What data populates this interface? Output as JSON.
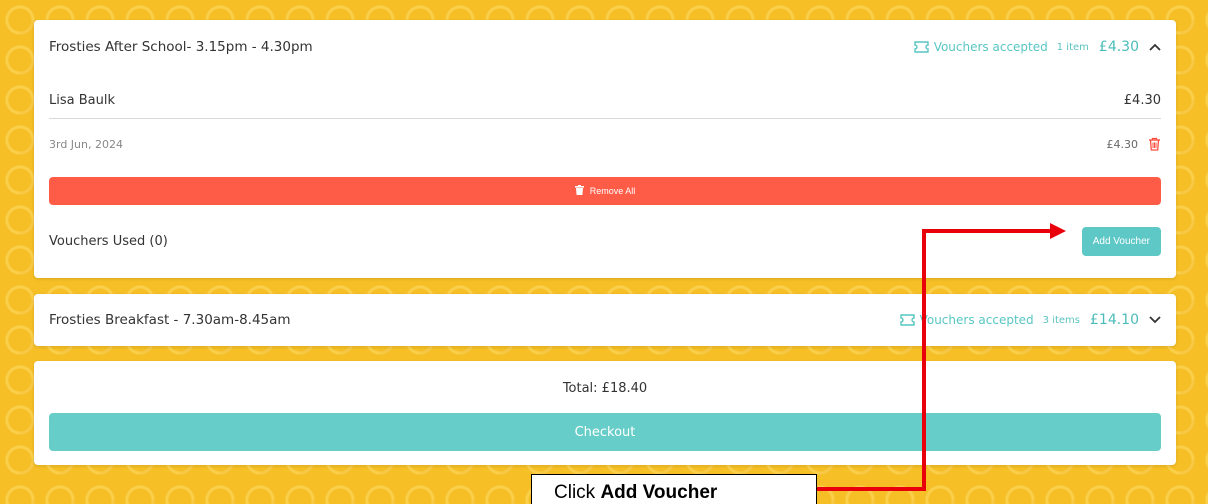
{
  "cards": [
    {
      "title": "Frosties After School- 3.15pm - 4.30pm",
      "vouchers_accepted": "Vouchers accepted",
      "item_count": "1 item",
      "price": "£4.30",
      "expanded": true,
      "child": {
        "name": "Lisa Baulk",
        "price": "£4.30"
      },
      "booking": {
        "date": "3rd Jun, 2024",
        "price": "£4.30"
      },
      "remove_all_label": "Remove All",
      "vouchers_used_label": "Vouchers Used (0)",
      "add_voucher_label": "Add Voucher"
    },
    {
      "title": "Frosties Breakfast - 7.30am-8.45am",
      "vouchers_accepted": "Vouchers accepted",
      "item_count": "3 items",
      "price": "£14.10",
      "expanded": false
    }
  ],
  "summary": {
    "total": "Total: £18.40",
    "checkout_label": "Checkout"
  },
  "annotation": {
    "callout_prefix": "Click ",
    "callout_bold": "Add Voucher"
  },
  "icons": {
    "voucher": "ticket-icon",
    "expand": "chevron-up-icon",
    "collapse": "chevron-down-icon",
    "delete": "trash-icon"
  },
  "colors": {
    "accent_teal": "#5ec8c6",
    "danger_red": "#ff5c48",
    "background_yellow": "#f6bf26",
    "annotation_red": "#e8000b"
  }
}
